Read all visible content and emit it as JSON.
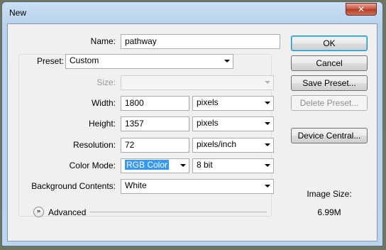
{
  "window": {
    "title": "New",
    "close_glyph": "✕"
  },
  "form": {
    "name_label": "Name:",
    "name_value": "pathway",
    "preset_label": "Preset:",
    "preset_value": "Custom",
    "size_label": "Size:",
    "size_value": "",
    "width_label": "Width:",
    "width_value": "1800",
    "width_unit": "pixels",
    "height_label": "Height:",
    "height_value": "1357",
    "height_unit": "pixels",
    "resolution_label": "Resolution:",
    "resolution_value": "72",
    "resolution_unit": "pixels/inch",
    "color_mode_label": "Color Mode:",
    "color_mode_value": "RGB Color",
    "bit_depth_value": "8 bit",
    "background_label": "Background Contents:",
    "background_value": "White",
    "advanced_label": "Advanced",
    "advanced_icon": "double-chevron-down-icon"
  },
  "buttons": {
    "ok": "OK",
    "cancel": "Cancel",
    "save_preset": "Save Preset...",
    "delete_preset": "Delete Preset...",
    "device_central": "Device Central..."
  },
  "image_size": {
    "label": "Image Size:",
    "value": "6.99M"
  },
  "colors": {
    "selection": "#3399ff",
    "default_button_border": "#3c7fb1",
    "close_button": "#c7533d"
  }
}
